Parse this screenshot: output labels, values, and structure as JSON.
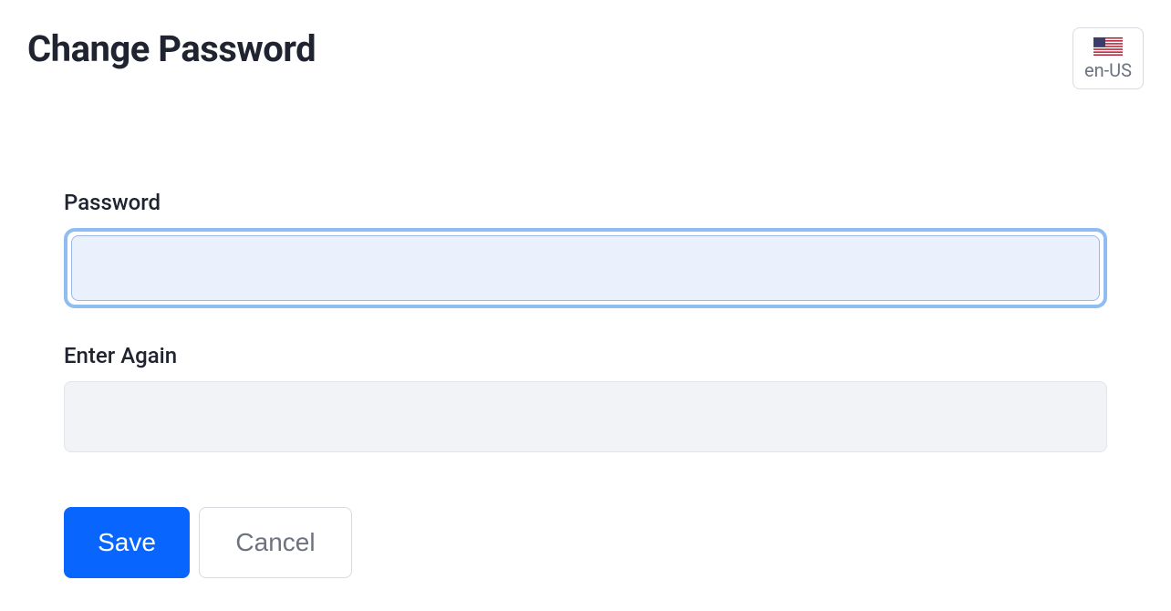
{
  "header": {
    "title": "Change Password"
  },
  "locale": {
    "code": "en-US"
  },
  "form": {
    "password": {
      "label": "Password",
      "value": ""
    },
    "confirm": {
      "label": "Enter Again",
      "value": ""
    }
  },
  "actions": {
    "save": "Save",
    "cancel": "Cancel"
  }
}
